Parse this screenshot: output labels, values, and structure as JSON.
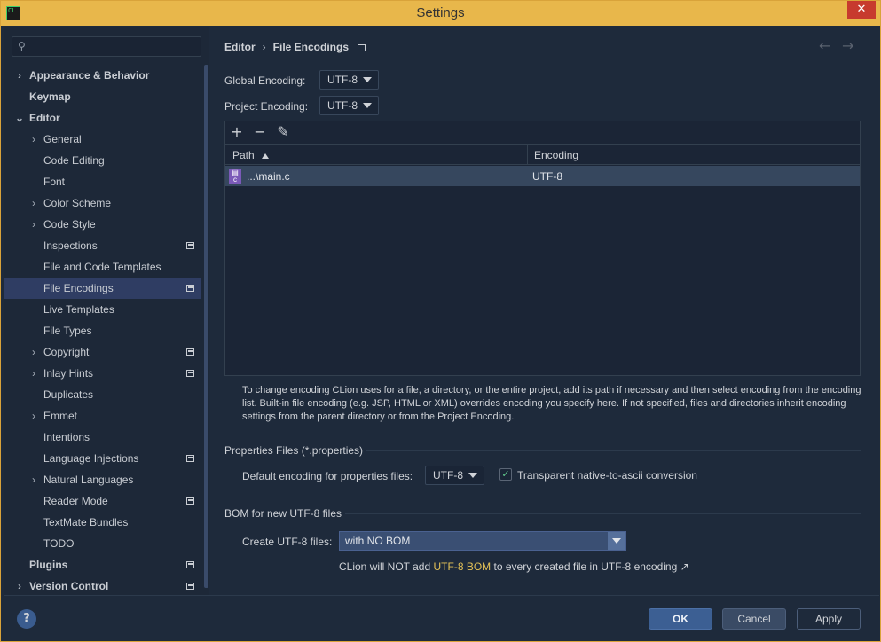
{
  "window": {
    "title": "Settings",
    "close_label": "✕"
  },
  "sidebar": {
    "items": [
      {
        "label": "Appearance & Behavior",
        "expandable": true,
        "bold": true
      },
      {
        "label": "Keymap",
        "bold": true
      },
      {
        "label": "Editor",
        "expandable": true,
        "expanded": true,
        "bold": true
      },
      {
        "label": "General",
        "expandable": true
      },
      {
        "label": "Code Editing"
      },
      {
        "label": "Font"
      },
      {
        "label": "Color Scheme",
        "expandable": true
      },
      {
        "label": "Code Style",
        "expandable": true
      },
      {
        "label": "Inspections",
        "project": true
      },
      {
        "label": "File and Code Templates"
      },
      {
        "label": "File Encodings",
        "selected": true,
        "project": true
      },
      {
        "label": "Live Templates"
      },
      {
        "label": "File Types"
      },
      {
        "label": "Copyright",
        "expandable": true,
        "project": true
      },
      {
        "label": "Inlay Hints",
        "expandable": true,
        "project": true
      },
      {
        "label": "Duplicates"
      },
      {
        "label": "Emmet",
        "expandable": true
      },
      {
        "label": "Intentions"
      },
      {
        "label": "Language Injections",
        "project": true
      },
      {
        "label": "Natural Languages",
        "expandable": true
      },
      {
        "label": "Reader Mode",
        "project": true
      },
      {
        "label": "TextMate Bundles"
      },
      {
        "label": "TODO"
      },
      {
        "label": "Plugins",
        "bold": true,
        "project": true
      },
      {
        "label": "Version Control",
        "expandable": true,
        "bold": true,
        "project": true
      }
    ]
  },
  "breadcrumb": {
    "parent": "Editor",
    "current": "File Encodings"
  },
  "global_encoding": {
    "label": "Global Encoding:",
    "value": "UTF-8"
  },
  "project_encoding": {
    "label": "Project Encoding:",
    "value": "UTF-8"
  },
  "table": {
    "columns": [
      "Path",
      "Encoding"
    ],
    "rows": [
      {
        "path": "...\\main.c",
        "encoding": "UTF-8",
        "icon": "c-file-icon"
      }
    ]
  },
  "help_text": "To change encoding CLion uses for a file, a directory, or the entire project, add its path if necessary and then select encoding from the encoding list. Built-in file encoding (e.g. JSP, HTML or XML) overrides encoding you specify here. If not specified, files and directories inherit encoding settings from the parent directory or from the Project Encoding.",
  "properties": {
    "section_title": "Properties Files (*.properties)",
    "default_label": "Default encoding for properties files:",
    "default_value": "UTF-8",
    "transparent_label": "Transparent native-to-ascii conversion",
    "transparent_checked": true
  },
  "bom": {
    "section_title": "BOM for new UTF-8 files",
    "create_label": "Create UTF-8 files:",
    "create_value": "with NO BOM",
    "note_prefix": "CLion will NOT add ",
    "note_highlight": "UTF-8 BOM",
    "note_suffix": " to every created file in UTF-8 encoding ↗"
  },
  "footer": {
    "ok": "OK",
    "cancel": "Cancel",
    "apply": "Apply",
    "help": "?"
  }
}
